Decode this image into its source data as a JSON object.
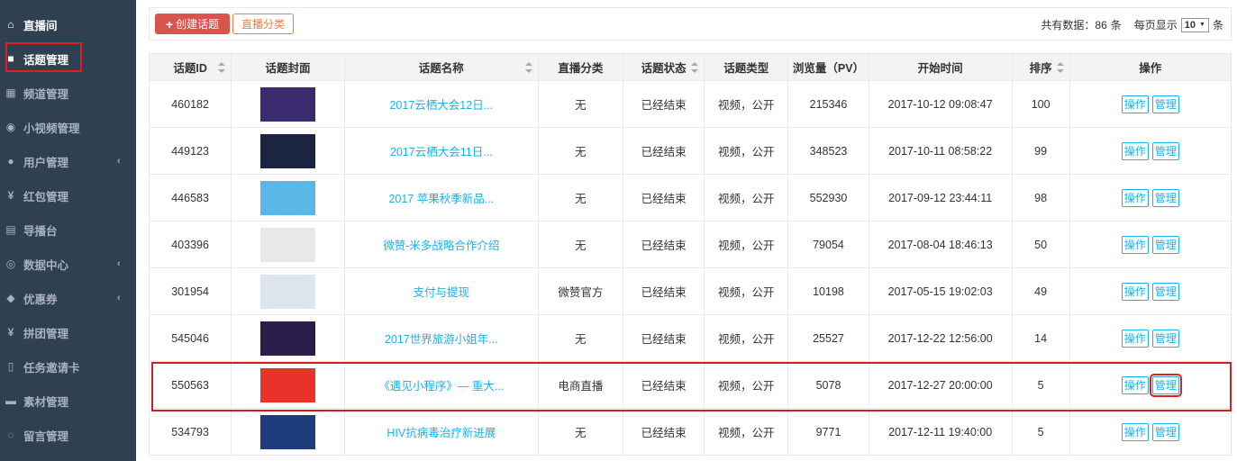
{
  "sidebar": {
    "items": [
      {
        "label": "直播间",
        "icon": "home-icon",
        "glyph": "⌂"
      },
      {
        "label": "话题管理",
        "icon": "video-camera-icon",
        "glyph": "■"
      },
      {
        "label": "频道管理",
        "icon": "grid-icon",
        "glyph": "▦"
      },
      {
        "label": "小视频管理",
        "icon": "play-circle-icon",
        "glyph": "◉"
      },
      {
        "label": "用户管理",
        "icon": "user-icon",
        "glyph": "●",
        "chevron": "‹"
      },
      {
        "label": "红包管理",
        "icon": "yen-icon",
        "glyph": "¥"
      },
      {
        "label": "导播台",
        "icon": "monitor-icon",
        "glyph": "▤"
      },
      {
        "label": "数据中心",
        "icon": "eye-icon",
        "glyph": "◎",
        "chevron": "‹"
      },
      {
        "label": "优惠券",
        "icon": "tag-icon",
        "glyph": "◆",
        "chevron": "‹"
      },
      {
        "label": "拼团管理",
        "icon": "yen-icon",
        "glyph": "¥"
      },
      {
        "label": "任务邀请卡",
        "icon": "card-icon",
        "glyph": "▯"
      },
      {
        "label": "素材管理",
        "icon": "image-icon",
        "glyph": "▬"
      },
      {
        "label": "留言管理",
        "icon": "comment-icon",
        "glyph": "◌"
      }
    ]
  },
  "toolbar": {
    "create_label": "创建话题",
    "category_label": "直播分类",
    "total_prefix": "共有数据：",
    "total_count": "86",
    "total_suffix": "条",
    "per_page_prefix": "每页显示",
    "per_page_value": "10",
    "per_page_suffix": "条"
  },
  "table": {
    "headers": [
      "话题ID",
      "话题封面",
      "话题名称",
      "直播分类",
      "话题状态",
      "话题类型",
      "浏览量（PV）",
      "开始时间",
      "排序",
      "操作"
    ],
    "op_label": "操作",
    "manage_label": "管理",
    "rows": [
      {
        "id": "460182",
        "name": "2017云栖大会12日...",
        "category": "无",
        "status": "已经结束",
        "type": "视频，公开",
        "pv": "215346",
        "start": "2017-10-12 09:08:47",
        "order": "100",
        "cover_color": "#3a2a6e"
      },
      {
        "id": "449123",
        "name": "2017云栖大会11日...",
        "category": "无",
        "status": "已经结束",
        "type": "视频，公开",
        "pv": "348523",
        "start": "2017-10-11 08:58:22",
        "order": "99",
        "cover_color": "#1c2540"
      },
      {
        "id": "446583",
        "name": "2017 苹果秋季新品...",
        "category": "无",
        "status": "已经结束",
        "type": "视频，公开",
        "pv": "552930",
        "start": "2017-09-12 23:44:11",
        "order": "98",
        "cover_color": "#5ab7e8"
      },
      {
        "id": "403396",
        "name": "微赞-米多战略合作介绍",
        "category": "无",
        "status": "已经结束",
        "type": "视频，公开",
        "pv": "79054",
        "start": "2017-08-04 18:46:13",
        "order": "50",
        "cover_color": "#e8e8e8"
      },
      {
        "id": "301954",
        "name": "支付与提现",
        "category": "微赞官方",
        "status": "已经结束",
        "type": "视频，公开",
        "pv": "10198",
        "start": "2017-05-15 19:02:03",
        "order": "49",
        "cover_color": "#dde6ee"
      },
      {
        "id": "545046",
        "name": "2017世界旅游小姐年...",
        "category": "无",
        "status": "已经结束",
        "type": "视频，公开",
        "pv": "25527",
        "start": "2017-12-22 12:56:00",
        "order": "14",
        "cover_color": "#2a1f4a"
      },
      {
        "id": "550563",
        "name": "《遇见小程序》— 重大...",
        "category": "电商直播",
        "status": "已经结束",
        "type": "视频，公开",
        "pv": "5078",
        "start": "2017-12-27 20:00:00",
        "order": "5",
        "cover_color": "#e8322a"
      },
      {
        "id": "534793",
        "name": "HIV抗病毒治疗新进展",
        "category": "无",
        "status": "已经结束",
        "type": "视频，公开",
        "pv": "9771",
        "start": "2017-12-11 19:40:00",
        "order": "5",
        "cover_color": "#1e3d7a"
      }
    ]
  }
}
